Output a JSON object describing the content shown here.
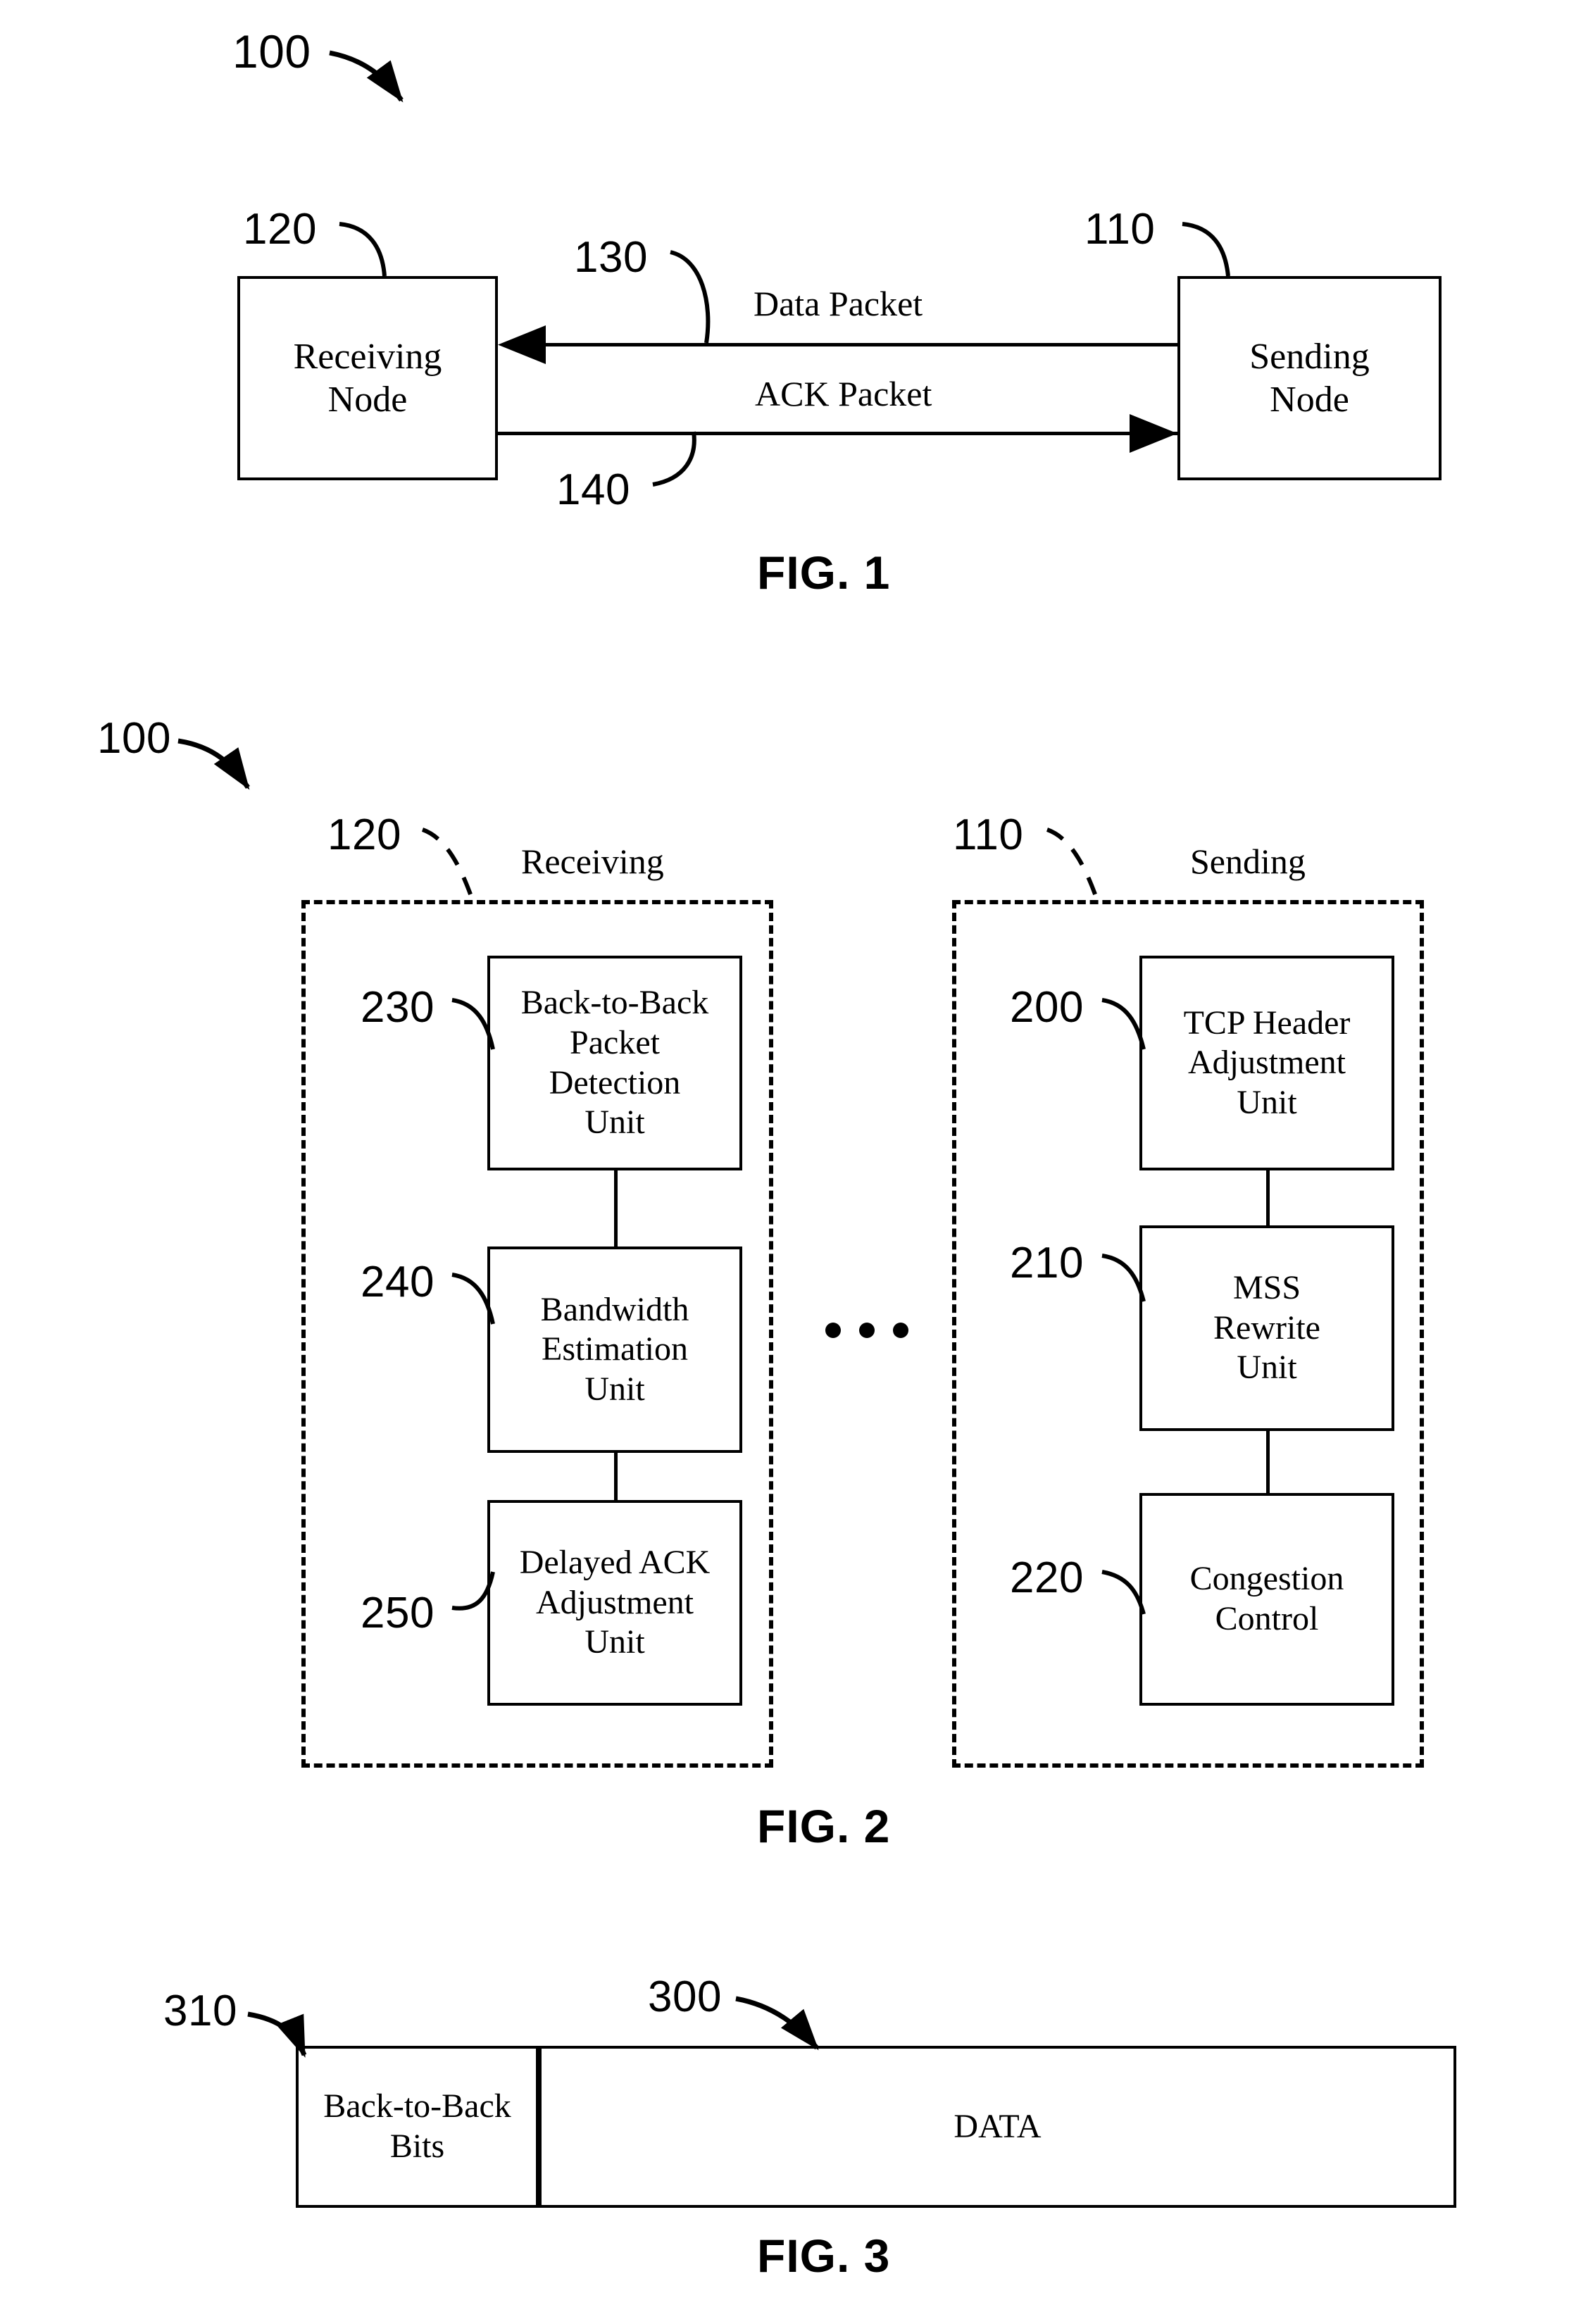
{
  "figures": [
    {
      "id": "fig1",
      "label": "FIG. 1",
      "system_ref": "100",
      "nodes": [
        {
          "ref": "120",
          "label": "Receiving\nNode"
        },
        {
          "ref": "110",
          "label": "Sending\nNode"
        }
      ],
      "flows": [
        {
          "ref": "130",
          "label": "Data Packet",
          "direction": "right-to-left"
        },
        {
          "ref": "140",
          "label": "ACK Packet",
          "direction": "left-to-right"
        }
      ]
    },
    {
      "id": "fig2",
      "label": "FIG. 2",
      "system_ref": "100",
      "groups": [
        {
          "ref": "120",
          "title": "Receiving",
          "units": [
            {
              "ref": "230",
              "label": "Back-to-Back\nPacket\nDetection\nUnit"
            },
            {
              "ref": "240",
              "label": "Bandwidth\nEstimation\nUnit"
            },
            {
              "ref": "250",
              "label": "Delayed ACK\nAdjustment\nUnit"
            }
          ]
        },
        {
          "ref": "110",
          "title": "Sending",
          "units": [
            {
              "ref": "200",
              "label": "TCP Header\nAdjustment\nUnit"
            },
            {
              "ref": "210",
              "label": "MSS\nRewrite\nUnit"
            },
            {
              "ref": "220",
              "label": "Congestion\nControl"
            }
          ]
        }
      ],
      "ellipsis": "•••"
    },
    {
      "id": "fig3",
      "label": "FIG. 3",
      "packet_ref": "300",
      "fields": [
        {
          "ref": "310",
          "label": "Back-to-Back\nBits"
        },
        {
          "ref": "",
          "label": "DATA"
        }
      ]
    }
  ],
  "fig1": {
    "label": "FIG. 1",
    "ref_system": "100",
    "ref_receiving": "120",
    "ref_sending": "110",
    "ref_data": "130",
    "ref_ack": "140",
    "receiving_line1": "Receiving",
    "receiving_line2": "Node",
    "sending_line1": "Sending",
    "sending_line2": "Node",
    "data_packet": "Data Packet",
    "ack_packet": "ACK Packet"
  },
  "fig2": {
    "label": "FIG. 2",
    "ref_system": "100",
    "ref_receiving_group": "120",
    "ref_sending_group": "110",
    "receiving_title": "Receiving",
    "sending_title": "Sending",
    "ref_230": "230",
    "ref_240": "240",
    "ref_250": "250",
    "ref_200": "200",
    "ref_210": "210",
    "ref_220": "220",
    "b2b_l1": "Back-to-Back",
    "b2b_l2": "Packet",
    "b2b_l3": "Detection",
    "b2b_l4": "Unit",
    "bw_l1": "Bandwidth",
    "bw_l2": "Estimation",
    "bw_l3": "Unit",
    "dack_l1": "Delayed ACK",
    "dack_l2": "Adjustment",
    "dack_l3": "Unit",
    "tcp_l1": "TCP Header",
    "tcp_l2": "Adjustment",
    "tcp_l3": "Unit",
    "mss_l1": "MSS",
    "mss_l2": "Rewrite",
    "mss_l3": "Unit",
    "cc_l1": "Congestion",
    "cc_l2": "Control"
  },
  "fig3": {
    "label": "FIG. 3",
    "ref_packet": "300",
    "ref_bits": "310",
    "bits_l1": "Back-to-Back",
    "bits_l2": "Bits",
    "data_label": "DATA"
  },
  "colors": {
    "ink": "#000000",
    "paper": "#ffffff"
  }
}
